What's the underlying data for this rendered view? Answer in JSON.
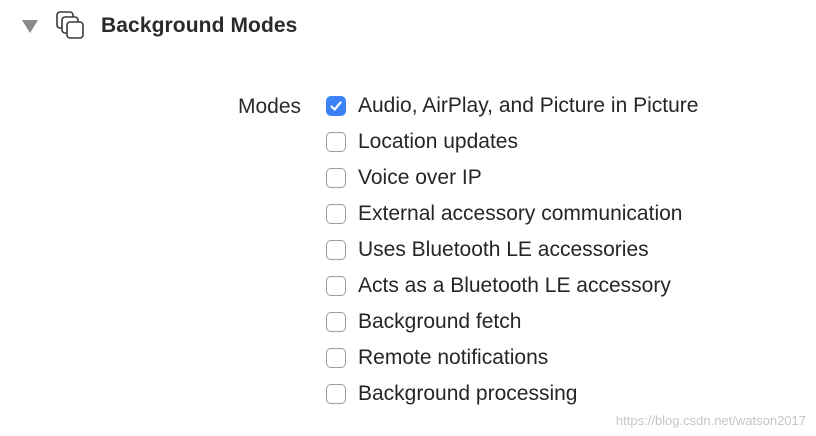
{
  "section": {
    "title": "Background Modes",
    "icon": "capability-stack-icon"
  },
  "modes": {
    "label": "Modes",
    "options": [
      {
        "label": "Audio, AirPlay, and Picture in Picture",
        "checked": true
      },
      {
        "label": "Location updates",
        "checked": false
      },
      {
        "label": "Voice over IP",
        "checked": false
      },
      {
        "label": "External accessory communication",
        "checked": false
      },
      {
        "label": "Uses Bluetooth LE accessories",
        "checked": false
      },
      {
        "label": "Acts as a Bluetooth LE accessory",
        "checked": false
      },
      {
        "label": "Background fetch",
        "checked": false
      },
      {
        "label": "Remote notifications",
        "checked": false
      },
      {
        "label": "Background processing",
        "checked": false
      }
    ]
  },
  "watermark": "https://blog.csdn.net/watson2017",
  "colors": {
    "checked": "#3b82f6",
    "text": "#262626"
  }
}
